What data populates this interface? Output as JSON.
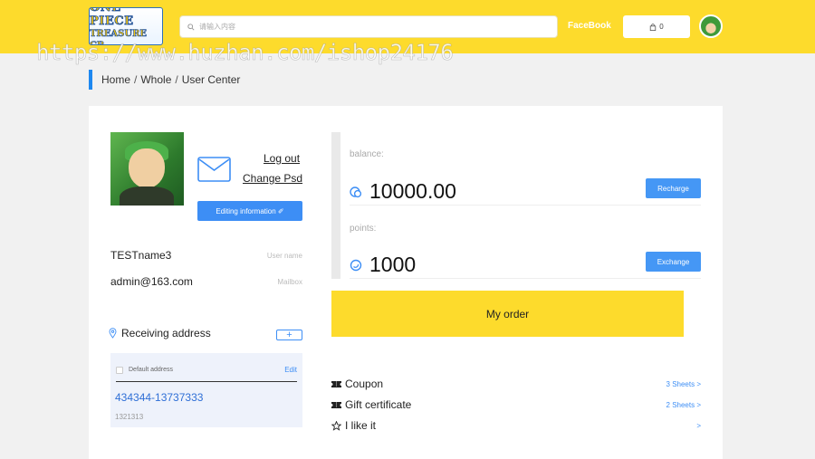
{
  "header": {
    "logo_line1": "ONE PIECE",
    "logo_line2": "TREASURE CR",
    "search_placeholder": "请输入内容",
    "facebook_label": "FaceBook",
    "cart_count": "0",
    "accent_color": "#fddb2c"
  },
  "watermark": "https://www.huzhan.com/ishop24176",
  "breadcrumb": {
    "items": [
      "Home",
      "Whole",
      "User Center"
    ],
    "separator": "/"
  },
  "profile": {
    "logout_label": "Log out",
    "change_psd_label": "Change Psd",
    "edit_button_label": "Editing information ✐",
    "name_value": "TESTname3",
    "name_key": "User name",
    "mail_value": "admin@163.com",
    "mail_key": "Mailbox"
  },
  "address": {
    "title": "Receiving address",
    "add_label": "+",
    "default_label": "Default address",
    "edit_label": "Edit",
    "phone": "434344-13737333",
    "sub": "1321313"
  },
  "wallet": {
    "balance_label": "balance:",
    "balance_value": "10000.00",
    "recharge_label": "Recharge",
    "points_label": "points:",
    "points_value": "1000",
    "exchange_label": "Exchange"
  },
  "order_button": "My order",
  "list": [
    {
      "icon": "ticket-icon",
      "label": "Coupon",
      "right": "3 Sheets >"
    },
    {
      "icon": "ticket-icon",
      "label": "Gift certificate",
      "right": "2 Sheets >"
    },
    {
      "icon": "star-icon",
      "label": "I like it",
      "right": ">"
    }
  ],
  "colors": {
    "primary_blue": "#3d8ef5",
    "breadcrumb_bar": "#1e88f0",
    "yellow": "#fddb2c"
  }
}
